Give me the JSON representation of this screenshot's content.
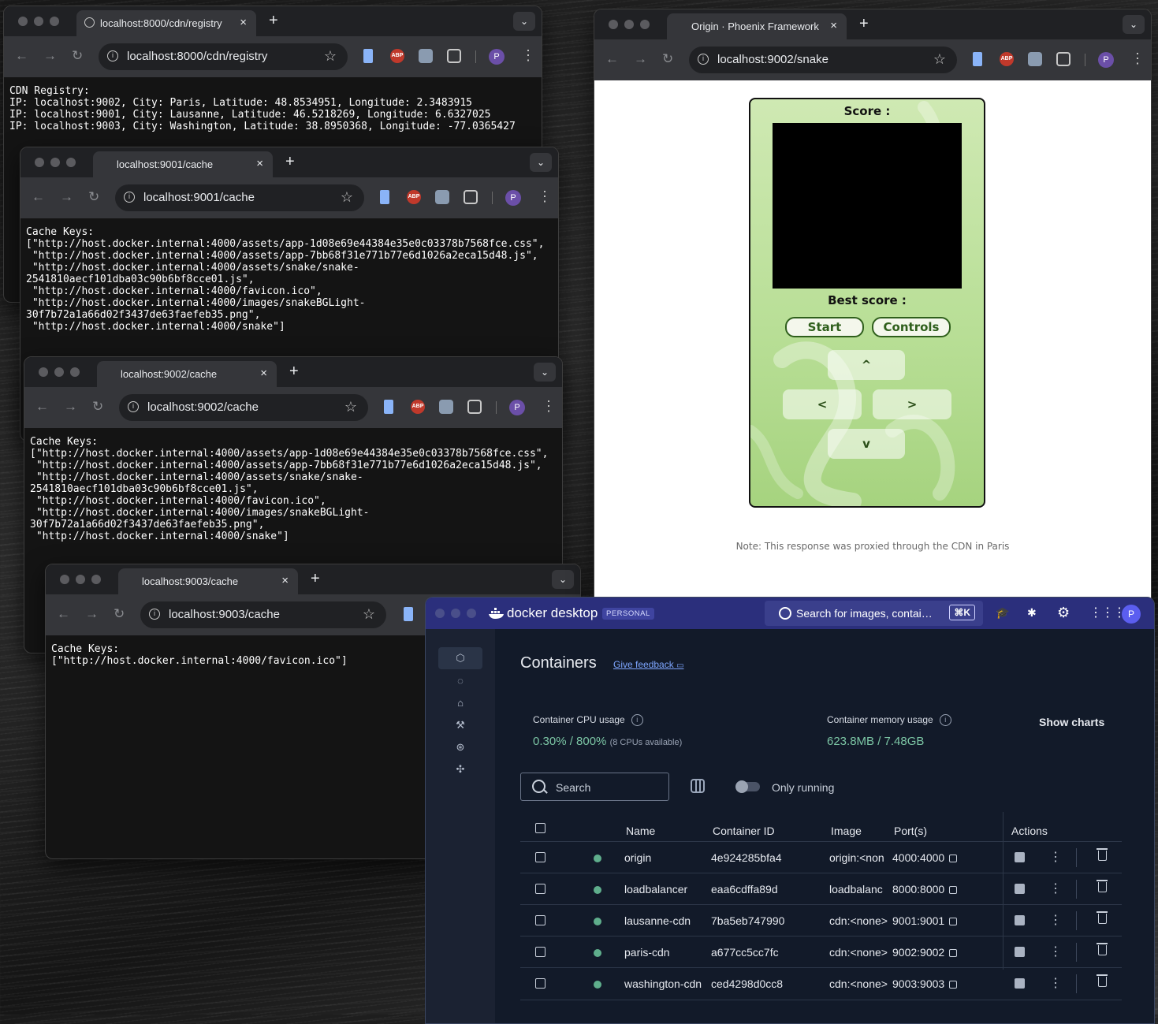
{
  "registry_window": {
    "tab_title": "localhost:8000/cdn/registry",
    "url": "localhost:8000/cdn/registry",
    "content": "CDN Registry:\nIP: localhost:9002, City: Paris, Latitude: 48.8534951, Longitude: 2.3483915\nIP: localhost:9001, City: Lausanne, Latitude: 46.5218269, Longitude: 6.6327025\nIP: localhost:9003, City: Washington, Latitude: 38.8950368, Longitude: -77.0365427"
  },
  "cache_9001_window": {
    "tab_title": "localhost:9001/cache",
    "url": "localhost:9001/cache",
    "content": "Cache Keys:\n[\"http://host.docker.internal:4000/assets/app-1d08e69e44384e35e0c03378b7568fce.css\",\n \"http://host.docker.internal:4000/assets/app-7bb68f31e771b77e6d1026a2eca15d48.js\",\n \"http://host.docker.internal:4000/assets/snake/snake-\n2541810aecf101dba03c90b6bf8cce01.js\",\n \"http://host.docker.internal:4000/favicon.ico\",\n \"http://host.docker.internal:4000/images/snakeBGLight-\n30f7b72a1a66d02f3437de63faefeb35.png\",\n \"http://host.docker.internal:4000/snake\"]"
  },
  "cache_9002_window": {
    "tab_title": "localhost:9002/cache",
    "url": "localhost:9002/cache",
    "content": "Cache Keys:\n[\"http://host.docker.internal:4000/assets/app-1d08e69e44384e35e0c03378b7568fce.css\",\n \"http://host.docker.internal:4000/assets/app-7bb68f31e771b77e6d1026a2eca15d48.js\",\n \"http://host.docker.internal:4000/assets/snake/snake-\n2541810aecf101dba03c90b6bf8cce01.js\",\n \"http://host.docker.internal:4000/favicon.ico\",\n \"http://host.docker.internal:4000/images/snakeBGLight-\n30f7b72a1a66d02f3437de63faefeb35.png\",\n \"http://host.docker.internal:4000/snake\"]"
  },
  "cache_9003_window": {
    "tab_title": "localhost:9003/cache",
    "url": "localhost:9003/cache",
    "content": "Cache Keys:\n[\"http://host.docker.internal:4000/favicon.ico\"]"
  },
  "snake_window": {
    "tab_title": "Origin · Phoenix Framework",
    "url": "localhost:9002/snake",
    "score_label": "Score :",
    "best_score_label": "Best score :",
    "start_label": "Start",
    "controls_label": "Controls",
    "up_label": "^",
    "left_label": "<",
    "right_label": ">",
    "down_label": "v",
    "note": "Note: This response was proxied through the CDN in Paris"
  },
  "browser_common": {
    "abp_label": "ABP",
    "avatar_letter": "P",
    "new_tab": "+",
    "close": "×",
    "back": "←",
    "forward": "→",
    "reload": "↻",
    "star": "☆",
    "kebab": "⋮",
    "tab_menu": "⌄",
    "info": "i"
  },
  "docker": {
    "brand": "docker desktop",
    "plan_badge": "PERSONAL",
    "search_placeholder": "Search for images, contai…",
    "shortcut": "⌘K",
    "avatar_letter": "P",
    "page_title": "Containers",
    "feedback_link": "Give feedback",
    "cpu_label": "Container CPU usage",
    "cpu_value": "0.30% / 800%",
    "cpu_sub": "(8 CPUs available)",
    "mem_label": "Container memory usage",
    "mem_value": "623.8MB / 7.48GB",
    "show_charts": "Show charts",
    "search_label": "Search",
    "only_running_label": "Only running",
    "columns": {
      "name": "Name",
      "container_id": "Container ID",
      "image": "Image",
      "ports": "Port(s)",
      "actions": "Actions"
    },
    "rows": [
      {
        "name": "origin",
        "id": "4e924285bfa4",
        "image": "origin:<non",
        "ports": "4000:4000"
      },
      {
        "name": "loadbalancer",
        "id": "eaa6cdffa89d",
        "image": "loadbalanc",
        "ports": "8000:8000"
      },
      {
        "name": "lausanne-cdn",
        "id": "7ba5eb747990",
        "image": "cdn:<none>",
        "ports": "9001:9001"
      },
      {
        "name": "paris-cdn",
        "id": "a677cc5cc7fc",
        "image": "cdn:<none>",
        "ports": "9002:9002"
      },
      {
        "name": "washington-cdn",
        "id": "ced4298d0cc8",
        "image": "cdn:<none>",
        "ports": "9003:9003"
      }
    ],
    "colors": {
      "topbar": "#2b2f7c",
      "running_dot": "#5fae8c",
      "stat_value": "#7cc6a5"
    }
  }
}
